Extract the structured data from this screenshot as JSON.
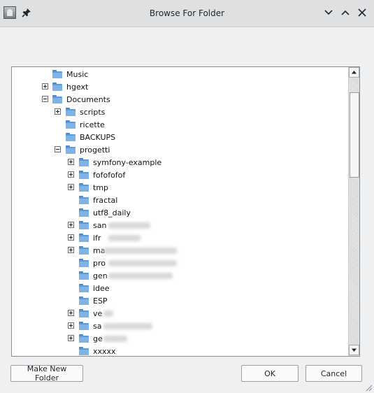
{
  "window": {
    "title": "Browse For Folder"
  },
  "tree": {
    "items": [
      {
        "label": "Music",
        "indent": 0,
        "expander": "none",
        "redacted": false
      },
      {
        "label": "hgext",
        "indent": 0,
        "expander": "plus",
        "redacted": false
      },
      {
        "label": "Documents",
        "indent": 0,
        "expander": "minus",
        "redacted": false
      },
      {
        "label": "scripts",
        "indent": 1,
        "expander": "plus",
        "redacted": false
      },
      {
        "label": "ricette",
        "indent": 1,
        "expander": "none",
        "redacted": false
      },
      {
        "label": "BACKUPS",
        "indent": 1,
        "expander": "none",
        "redacted": false
      },
      {
        "label": "progetti",
        "indent": 1,
        "expander": "minus",
        "redacted": false
      },
      {
        "label": "symfony-example",
        "indent": 2,
        "expander": "plus",
        "redacted": false
      },
      {
        "label": "fofofofof",
        "indent": 2,
        "expander": "plus",
        "redacted": false
      },
      {
        "label": "tmp",
        "indent": 2,
        "expander": "plus",
        "redacted": false
      },
      {
        "label": "fractal",
        "indent": 2,
        "expander": "none",
        "redacted": false
      },
      {
        "label": "utf8_daily",
        "indent": 2,
        "expander": "none",
        "redacted": false
      },
      {
        "label": "san",
        "indent": 2,
        "expander": "plus",
        "redacted": true
      },
      {
        "label": "ifr",
        "indent": 2,
        "expander": "plus",
        "redacted": true
      },
      {
        "label": "ma",
        "indent": 2,
        "expander": "plus",
        "redacted": true
      },
      {
        "label": "pro",
        "indent": 2,
        "expander": "none",
        "redacted": true
      },
      {
        "label": "gen",
        "indent": 2,
        "expander": "none",
        "redacted": true
      },
      {
        "label": "idee",
        "indent": 2,
        "expander": "none",
        "redacted": false
      },
      {
        "label": "ESP",
        "indent": 2,
        "expander": "none",
        "redacted": false
      },
      {
        "label": "ve",
        "indent": 2,
        "expander": "plus",
        "redacted": true
      },
      {
        "label": "sa",
        "indent": 2,
        "expander": "plus",
        "redacted": true
      },
      {
        "label": "ge",
        "indent": 2,
        "expander": "plus",
        "redacted": true
      },
      {
        "label": "xxxxx",
        "indent": 2,
        "expander": "none",
        "redacted": false
      }
    ]
  },
  "buttons": {
    "make_new_folder": "Make New Folder",
    "ok": "OK",
    "cancel": "Cancel"
  },
  "colors": {
    "folder": "#5d9ad8",
    "window_bg": "#eff0f1",
    "titlebar_bg": "#dee0e2"
  },
  "icons": {
    "app": "dialog-icon",
    "pin": "pin-icon",
    "minimize": "chevron-down-icon",
    "maximize": "chevron-up-icon",
    "close": "close-icon"
  }
}
